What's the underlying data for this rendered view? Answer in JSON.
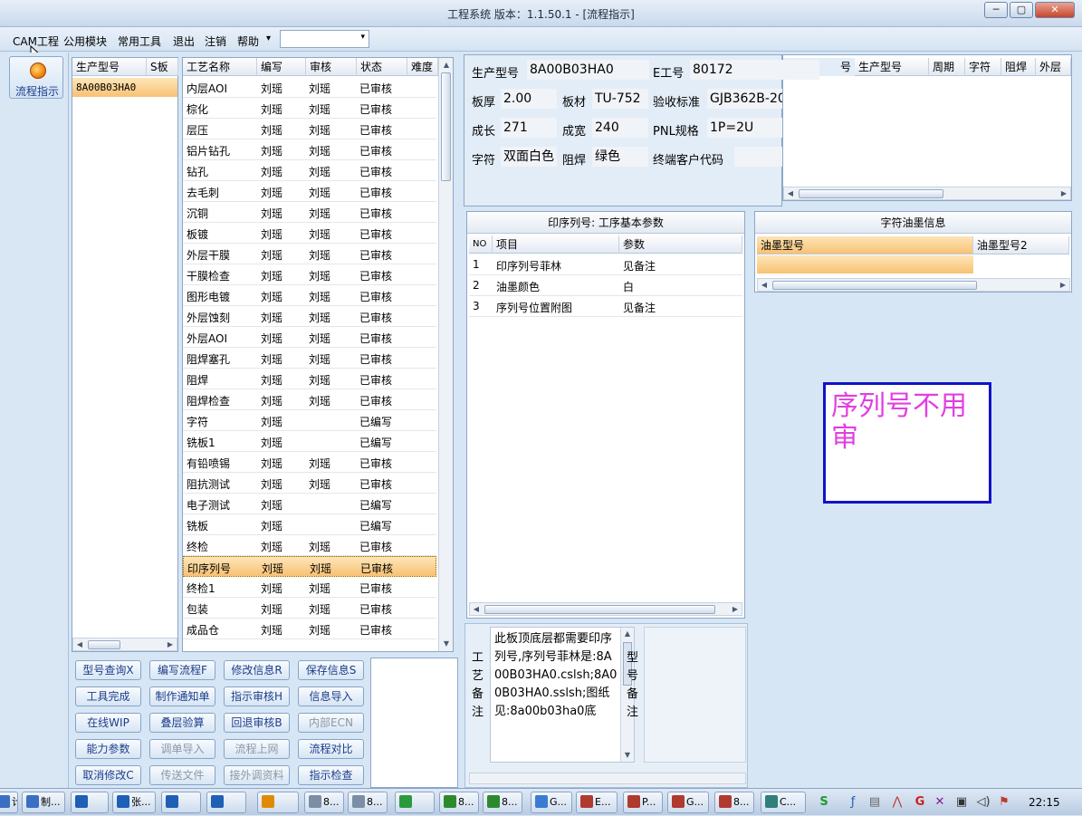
{
  "window": {
    "title": "工程系统   版本：1.1.50.1 - [流程指示]",
    "min": "─",
    "max": "▢",
    "close": "✕"
  },
  "menu": {
    "items": [
      "CAM工程",
      "公用模块",
      "常用工具",
      "退出",
      "注销",
      "帮助"
    ],
    "dropdown_arrow": "▾",
    "combo_value": "",
    "mdi_min": "_",
    "mdi_restore": "⧉",
    "mdi_close": "✕"
  },
  "sidebar": {
    "flow_button": "流程指示"
  },
  "model_list": {
    "headers": [
      "生产型号",
      "S板"
    ],
    "rows": [
      "8A00B03HA0"
    ]
  },
  "process_table": {
    "headers": [
      "工艺名称",
      "编写",
      "审核",
      "状态",
      "难度"
    ],
    "rows": [
      [
        "内层AOI",
        "刘瑶",
        "刘瑶",
        "已审核"
      ],
      [
        "棕化",
        "刘瑶",
        "刘瑶",
        "已审核"
      ],
      [
        "层压",
        "刘瑶",
        "刘瑶",
        "已审核"
      ],
      [
        "铝片钻孔",
        "刘瑶",
        "刘瑶",
        "已审核"
      ],
      [
        "钻孔",
        "刘瑶",
        "刘瑶",
        "已审核"
      ],
      [
        "去毛刺",
        "刘瑶",
        "刘瑶",
        "已审核"
      ],
      [
        "沉铜",
        "刘瑶",
        "刘瑶",
        "已审核"
      ],
      [
        "板镀",
        "刘瑶",
        "刘瑶",
        "已审核"
      ],
      [
        "外层干膜",
        "刘瑶",
        "刘瑶",
        "已审核"
      ],
      [
        "干膜检查",
        "刘瑶",
        "刘瑶",
        "已审核"
      ],
      [
        "图形电镀",
        "刘瑶",
        "刘瑶",
        "已审核"
      ],
      [
        "外层蚀刻",
        "刘瑶",
        "刘瑶",
        "已审核"
      ],
      [
        "外层AOI",
        "刘瑶",
        "刘瑶",
        "已审核"
      ],
      [
        "阻焊塞孔",
        "刘瑶",
        "刘瑶",
        "已审核"
      ],
      [
        "阻焊",
        "刘瑶",
        "刘瑶",
        "已审核"
      ],
      [
        "阻焊检查",
        "刘瑶",
        "刘瑶",
        "已审核"
      ],
      [
        "字符",
        "刘瑶",
        "",
        "已编写"
      ],
      [
        "铣板1",
        "刘瑶",
        "",
        "已编写"
      ],
      [
        "有铅喷锡",
        "刘瑶",
        "刘瑶",
        "已审核"
      ],
      [
        "阻抗测试",
        "刘瑶",
        "刘瑶",
        "已审核"
      ],
      [
        "电子测试",
        "刘瑶",
        "",
        "已编写"
      ],
      [
        "铣板",
        "刘瑶",
        "",
        "已编写"
      ],
      [
        "终检",
        "刘瑶",
        "刘瑶",
        "已审核"
      ],
      [
        "印序列号",
        "刘瑶",
        "刘瑶",
        "已审核"
      ],
      [
        "终检1",
        "刘瑶",
        "刘瑶",
        "已审核"
      ],
      [
        "包装",
        "刘瑶",
        "刘瑶",
        "已审核"
      ],
      [
        "成品仓",
        "刘瑶",
        "刘瑶",
        "已审核"
      ]
    ],
    "selected_index": 23
  },
  "info": {
    "fields": [
      {
        "label": "生产型号",
        "value": "8A00B03HA0"
      },
      {
        "label": "E工号",
        "value": "80172"
      },
      {
        "label": "板厚",
        "value": "2.00"
      },
      {
        "label": "板材",
        "value": "TU-752"
      },
      {
        "label": "验收标准",
        "value": "GJB362B-20"
      },
      {
        "label": "成长",
        "value": "271"
      },
      {
        "label": "成宽",
        "value": "240"
      },
      {
        "label": "PNL规格",
        "value": "1P=2U"
      },
      {
        "label": "字符",
        "value": "双面白色"
      },
      {
        "label": "阻焊",
        "value": "绿色"
      },
      {
        "label": "终端客户代码",
        "value": ""
      }
    ]
  },
  "right_grid": {
    "headers": [
      "号",
      "生产型号",
      "周期",
      "字符",
      "阻焊",
      "外层"
    ]
  },
  "params": {
    "title": "印序列号: 工序基本参数",
    "headers": [
      "NO",
      "项目",
      "参数"
    ],
    "rows": [
      [
        "1",
        "印序列号菲林",
        "见备注"
      ],
      [
        "2",
        "油墨颜色",
        "白"
      ],
      [
        "3",
        "序列号位置附图",
        "见备注"
      ]
    ]
  },
  "ink": {
    "title": "字符油墨信息",
    "headers": [
      "油墨型号",
      "油墨型号2"
    ]
  },
  "note": {
    "text": "序列号不用审"
  },
  "remarks": {
    "process_label": [
      "工",
      "艺",
      "备",
      "注"
    ],
    "process_text": "此板顶底层都需要印序列号,序列号菲林是:8A00B03HA0.cslsh;8A00B03HA0.sslsh;图纸见:8a00b03ha0底",
    "model_label": [
      "型",
      "号",
      "备",
      "注"
    ]
  },
  "buttons": [
    {
      "label": "型号查询X",
      "enabled": true
    },
    {
      "label": "编写流程F",
      "enabled": true
    },
    {
      "label": "修改信息R",
      "enabled": true
    },
    {
      "label": "保存信息S",
      "enabled": true
    },
    {
      "label": "工具完成",
      "enabled": true
    },
    {
      "label": "制作通知单",
      "enabled": true
    },
    {
      "label": "指示审核H",
      "enabled": true
    },
    {
      "label": "信息导入",
      "enabled": true
    },
    {
      "label": "在线WIP",
      "enabled": true
    },
    {
      "label": "叠层验算",
      "enabled": true
    },
    {
      "label": "回退审核B",
      "enabled": true
    },
    {
      "label": "内部ECN",
      "enabled": false
    },
    {
      "label": "能力参数",
      "enabled": true
    },
    {
      "label": "调单导入",
      "enabled": false
    },
    {
      "label": "流程上网",
      "enabled": false
    },
    {
      "label": "流程对比",
      "enabled": true
    },
    {
      "label": "取消修改C",
      "enabled": true
    },
    {
      "label": "传送文件",
      "enabled": false
    },
    {
      "label": "接外调资料",
      "enabled": false
    },
    {
      "label": "指示检查",
      "enabled": true
    }
  ],
  "taskbar": {
    "items": [
      {
        "label": "计...",
        "color": "#3a6fc4"
      },
      {
        "label": "制...",
        "color": "#3a6fc4"
      },
      {
        "label": "",
        "color": "#1f5fb5"
      },
      {
        "label": "张...",
        "color": "#1f5fb5"
      },
      {
        "label": "",
        "color": "#1f5fb5"
      },
      {
        "label": "",
        "color": "#1f5fb5"
      },
      {
        "label": "",
        "color": "#e08a00"
      },
      {
        "label": "8...",
        "color": "#7c8ea6"
      },
      {
        "label": "8...",
        "color": "#7c8ea6"
      },
      {
        "label": "",
        "color": "#2c9a3a"
      },
      {
        "label": "8...",
        "color": "#2c8a2c"
      },
      {
        "label": "8...",
        "color": "#2c8a2c"
      },
      {
        "label": "G...",
        "color": "#3b7bd1"
      },
      {
        "label": "E...",
        "color": "#b03a2e"
      },
      {
        "label": "P...",
        "color": "#b03a2e"
      },
      {
        "label": "G...",
        "color": "#b03a2e"
      },
      {
        "label": "8...",
        "color": "#b03a2e"
      },
      {
        "label": "C...",
        "color": "#2f7f7a"
      }
    ],
    "clock": "22:15"
  },
  "colors": {
    "accent": "#1b3d8a",
    "selection": "#f8c173",
    "note_text": "#e040e0",
    "note_border": "#1212c8"
  }
}
